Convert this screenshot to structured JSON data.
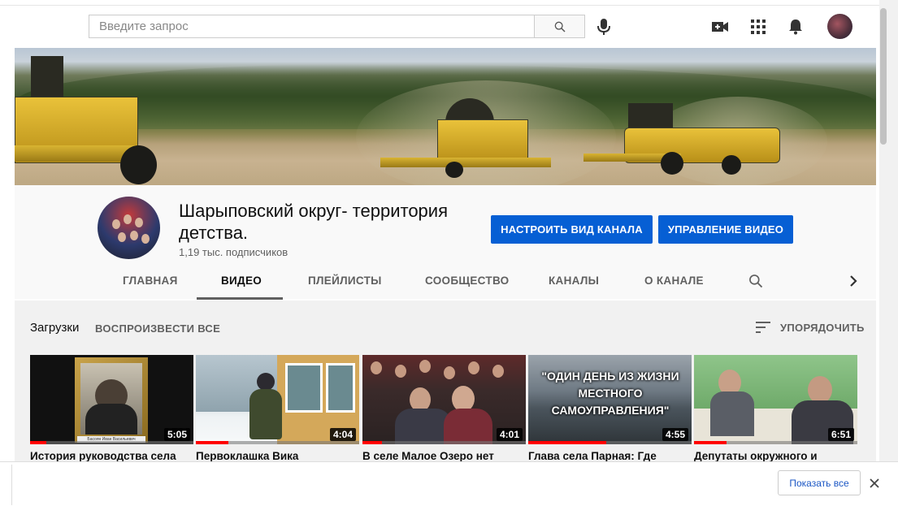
{
  "search": {
    "placeholder": "Введите запрос"
  },
  "channel": {
    "title": "Шарыповский округ- территория детства.",
    "subscribers": "1,19 тыс. подписчиков",
    "customize_label": "НАСТРОИТЬ ВИД КАНАЛА",
    "manage_label": "УПРАВЛЕНИЕ ВИДЕО"
  },
  "tabs": [
    {
      "label": "ГЛАВНАЯ"
    },
    {
      "label": "ВИДЕО"
    },
    {
      "label": "ПЛЕЙЛИСТЫ"
    },
    {
      "label": "СООБЩЕСТВО"
    },
    {
      "label": "КАНАЛЫ"
    },
    {
      "label": "О КАНАЛЕ"
    }
  ],
  "active_tab": "ВИДЕО",
  "section": {
    "title": "Загрузки",
    "play_all": "ВОСПРОИЗВЕСТИ ВСЕ",
    "sort": "УПОРЯДОЧИТЬ"
  },
  "videos": [
    {
      "title": "История руководства села",
      "duration": "5:05",
      "watched": 0.1,
      "thumb_caption": "Басоян Иван Васильевич"
    },
    {
      "title": "Первоклашка Вика",
      "duration": "4:04",
      "watched": 0.2
    },
    {
      "title": "В селе Малое Озеро нет",
      "duration": "4:01",
      "watched": 0.12
    },
    {
      "title": "Глава села Парная: Где",
      "duration": "4:55",
      "watched": 0.48,
      "thumb_text": "\"ОДИН ДЕНЬ ИЗ ЖИЗНИ МЕСТНОГО САМОУПРАВЛЕНИЯ\""
    },
    {
      "title": "Депутаты окружного и",
      "duration": "6:51",
      "watched": 0.2
    }
  ],
  "notification": {
    "show_all": "Показать все"
  }
}
